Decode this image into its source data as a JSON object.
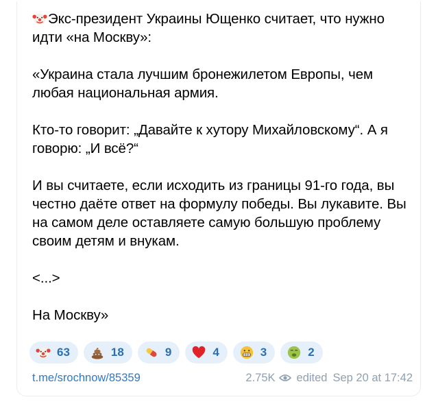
{
  "message": {
    "lead_icon": "clown-face-icon",
    "paragraphs": [
      "Экс-президент Украины Ющенко считает, что нужно идти «на Москву»:",
      "«Украина стала лучшим бронежилетом Европы, чем любая национальная армия.",
      "Кто-то говорит: „Давайте к хутору Михайловскому“. А я говорю: „И всё?“",
      "И вы считаете, если исходить из границы 91-го года, вы честно даёте ответ на формулу победы. Вы лукавите. Вы на самом деле оставляете самую большую проблему своим детям и внукам.",
      "<...>",
      "На Москву»"
    ]
  },
  "reactions": [
    {
      "icon": "clown-face-icon",
      "count": "63"
    },
    {
      "icon": "pile-of-poo-icon",
      "count": "18"
    },
    {
      "icon": "pill-icon",
      "count": "9"
    },
    {
      "icon": "red-heart-icon",
      "count": "4"
    },
    {
      "icon": "grimacing-face-icon",
      "count": "3"
    },
    {
      "icon": "nauseated-face-icon",
      "count": "2"
    }
  ],
  "footer": {
    "link": "t.me/srochnow/85359",
    "views": "2.75K",
    "edited_label": "edited",
    "timestamp": "Sep 20 at 17:42"
  },
  "colors": {
    "reaction_bg": "#e6f0fa",
    "reaction_count": "#2a6fb0",
    "link": "#2e79c4",
    "meta": "#8fa0b1"
  }
}
